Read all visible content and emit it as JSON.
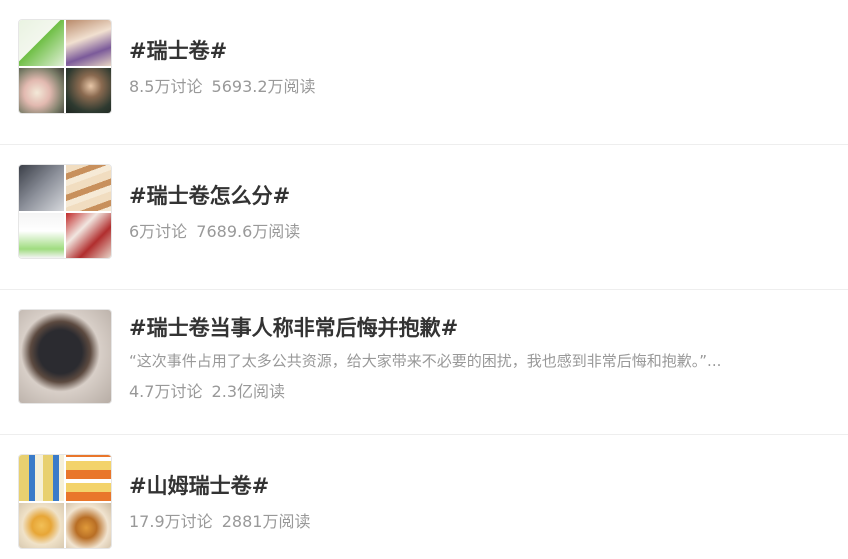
{
  "topics": [
    {
      "title": "#瑞士卷#",
      "desc": "",
      "discussions": "8.5万讨论",
      "reads": "5693.2万阅读",
      "thumbnail": "thumbnail-image"
    },
    {
      "title": "#瑞士卷怎么分#",
      "desc": "",
      "discussions": "6万讨论",
      "reads": "7689.6万阅读",
      "thumbnail": "thumbnail-image"
    },
    {
      "title": "#瑞士卷当事人称非常后悔并抱歉#",
      "desc": "“这次事件占用了太多公共资源，给大家带来不必要的困扰，我也感到非常后悔和抱歉。”...",
      "discussions": "4.7万讨论",
      "reads": "2.3亿阅读",
      "thumbnail": "thumbnail-image"
    },
    {
      "title": "#山姆瑞士卷#",
      "desc": "",
      "discussions": "17.9万讨论",
      "reads": "2881万阅读",
      "thumbnail": "thumbnail-image"
    }
  ]
}
